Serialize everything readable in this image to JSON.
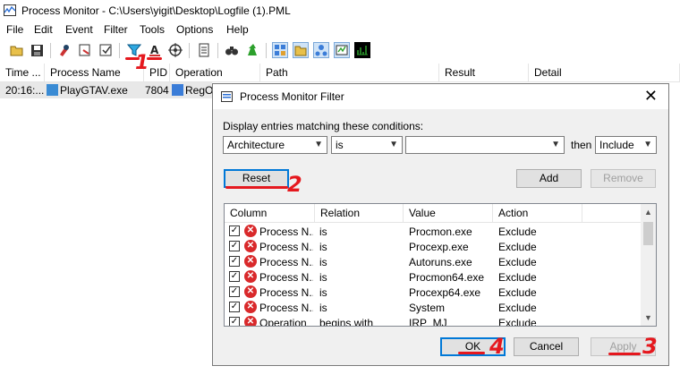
{
  "window": {
    "title": "Process Monitor - C:\\Users\\yigit\\Desktop\\Logfile (1).PML"
  },
  "menu": [
    "File",
    "Edit",
    "Event",
    "Filter",
    "Tools",
    "Options",
    "Help"
  ],
  "toolbar": {
    "icons": [
      "open-icon",
      "save-icon",
      "capture-icon",
      "autoscroll-icon",
      "clear-icon",
      "filter-icon",
      "highlight-icon",
      "target-icon",
      "properties-icon",
      "find-icon",
      "jump-icon",
      "registry-icon",
      "filesystem-icon",
      "network-icon",
      "process-icon",
      "profiling-icon"
    ]
  },
  "main": {
    "columns": [
      "Time ...",
      "Process Name",
      "PID",
      "Operation",
      "Path",
      "Result",
      "Detail"
    ],
    "rows": [
      {
        "time": "20:16:...",
        "process": "PlayGTAV.exe",
        "pid": "7804",
        "operation": "RegOp"
      }
    ]
  },
  "dialog": {
    "title": "Process Monitor Filter",
    "prompt": "Display entries matching these conditions:",
    "column_select": "Architecture",
    "relation_select": "is",
    "value_input": "",
    "then_label": "then",
    "action_select": "Include",
    "reset_label": "Reset",
    "add_label": "Add",
    "remove_label": "Remove",
    "list_headers": [
      "Column",
      "Relation",
      "Value",
      "Action"
    ],
    "rules": [
      {
        "column": "Process N...",
        "relation": "is",
        "value": "Procmon.exe",
        "action": "Exclude"
      },
      {
        "column": "Process N...",
        "relation": "is",
        "value": "Procexp.exe",
        "action": "Exclude"
      },
      {
        "column": "Process N...",
        "relation": "is",
        "value": "Autoruns.exe",
        "action": "Exclude"
      },
      {
        "column": "Process N...",
        "relation": "is",
        "value": "Procmon64.exe",
        "action": "Exclude"
      },
      {
        "column": "Process N...",
        "relation": "is",
        "value": "Procexp64.exe",
        "action": "Exclude"
      },
      {
        "column": "Process N...",
        "relation": "is",
        "value": "System",
        "action": "Exclude"
      },
      {
        "column": "Operation",
        "relation": "begins with",
        "value": "IRP_MJ_",
        "action": "Exclude"
      }
    ],
    "ok_label": "OK",
    "cancel_label": "Cancel",
    "apply_label": "Apply"
  },
  "annotations": {
    "step1": "1",
    "step2": "2",
    "step3": "3",
    "step4": "4"
  },
  "colors": {
    "annotation": "#e5181e",
    "default_button_border": "#0078d7",
    "error_icon": "#d9292b"
  }
}
